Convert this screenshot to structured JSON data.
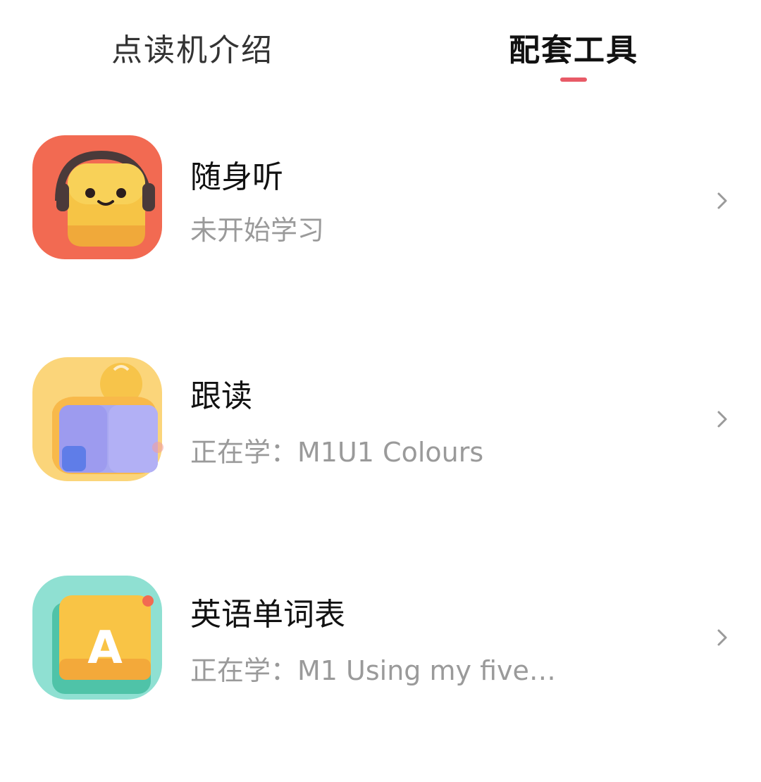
{
  "tabs": [
    {
      "label": "点读机介绍",
      "active": false
    },
    {
      "label": "配套工具",
      "active": true
    }
  ],
  "colors": {
    "accent": "#e85a67",
    "title": "#111111",
    "subtitle": "#9a9a9a"
  },
  "tools": [
    {
      "title": "随身听",
      "subtitle": "未开始学习",
      "icon": "headphone-face-icon"
    },
    {
      "title": "跟读",
      "subtitle": "正在学：M1U1 Colours",
      "icon": "reading-book-icon"
    },
    {
      "title": "英语单词表",
      "subtitle": "正在学：M1 Using my five…",
      "icon": "letter-a-book-icon"
    }
  ]
}
